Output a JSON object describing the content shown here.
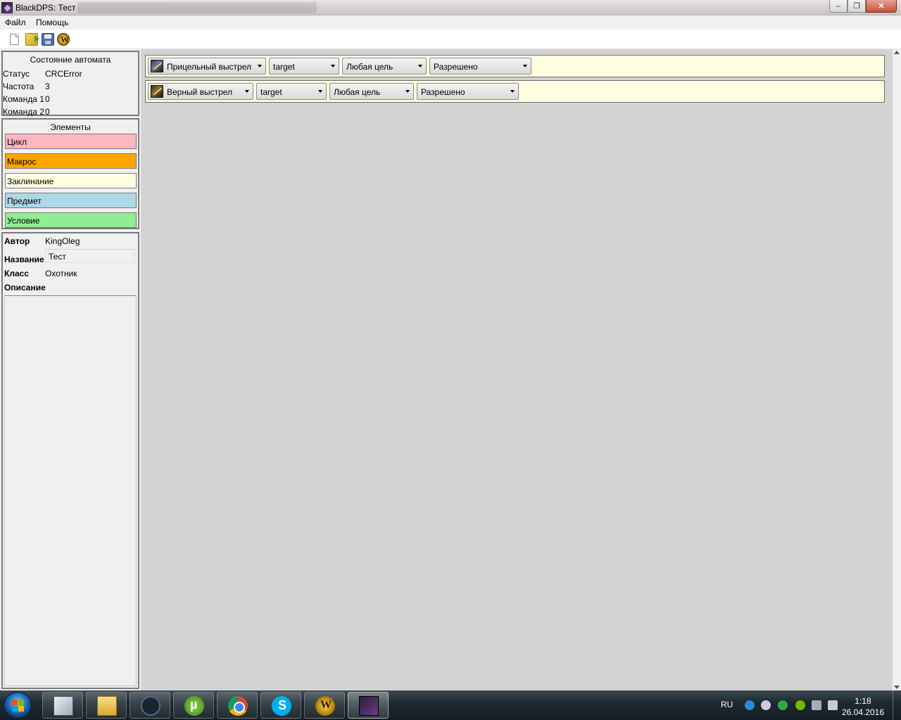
{
  "window": {
    "title": "BlackDPS: Тест"
  },
  "menu": {
    "file": "Файл",
    "help": "Помощь"
  },
  "toolbar": {
    "icons": [
      "new-document-icon",
      "open-folder-icon",
      "save-icon",
      "wow-icon"
    ]
  },
  "state": {
    "title": "Состояние автомата",
    "rows": [
      {
        "label": "Статус",
        "value": "CRCError"
      },
      {
        "label": "Частота",
        "value": "3"
      },
      {
        "label": "Команда 1",
        "value": "0"
      },
      {
        "label": "Команда 2",
        "value": "0"
      }
    ]
  },
  "elements": {
    "title": "Элементы",
    "items": [
      {
        "label": "Цикл",
        "color": "#ffb6c1"
      },
      {
        "label": "Макрос",
        "color": "#ffa500"
      },
      {
        "label": "Заклинание",
        "color": "#ffffe0"
      },
      {
        "label": "Предмет",
        "color": "#add8e6"
      },
      {
        "label": "Условие",
        "color": "#90ee90"
      }
    ]
  },
  "info": {
    "author_label": "Автор",
    "author_value": "KingOleg",
    "name_label": "Название",
    "name_value": "Тест",
    "class_label": "Класс",
    "class_value": "Охотник",
    "description_label": "Описание",
    "description_value": ""
  },
  "spells": [
    {
      "spell": "Прицельный выстрел",
      "target": "target",
      "filter": "Любая цель",
      "permission": "Разрешено"
    },
    {
      "spell": "Верный выстрел",
      "target": "target",
      "filter": "Любая цель",
      "permission": "Разрешено"
    }
  ],
  "taskbar": {
    "apps": [
      "explorer-app-icon",
      "folder-icon",
      "eclipse-icon",
      "utorrent-icon",
      "chrome-icon",
      "skype-icon",
      "wow-icon",
      "blackdps-icon"
    ],
    "language": "RU",
    "time": "1:18",
    "date": "26.04.2016"
  },
  "colors": {
    "spell_row_bg": "#ffffe0",
    "main_bg": "#d3d3d3"
  }
}
